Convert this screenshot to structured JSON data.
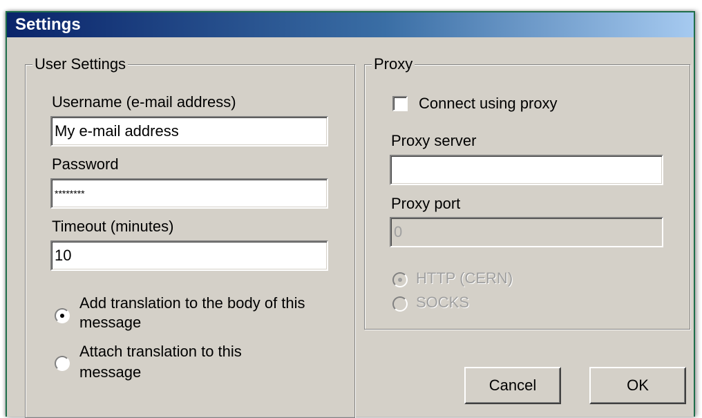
{
  "window": {
    "title": "Settings"
  },
  "user_settings": {
    "legend": "User Settings",
    "username_label": "Username (e-mail address)",
    "username_value": "My e-mail address",
    "password_label": "Password",
    "password_value": "********",
    "timeout_label": "Timeout (minutes)",
    "timeout_value": "10",
    "option_add_line1": "Add translation to the body of this",
    "option_add_line2": "message",
    "option_add_selected": true,
    "option_attach_line1": "Attach translation to this",
    "option_attach_line2": "message",
    "option_attach_selected": false
  },
  "proxy": {
    "legend": "Proxy",
    "connect_label": "Connect using proxy",
    "connect_checked": false,
    "server_label": "Proxy server",
    "server_value": "",
    "port_label": "Proxy port",
    "port_value": "0",
    "http_label": "HTTP (CERN)",
    "http_selected": true,
    "socks_label": "SOCKS",
    "socks_selected": false
  },
  "buttons": {
    "cancel": "Cancel",
    "ok": "OK"
  }
}
